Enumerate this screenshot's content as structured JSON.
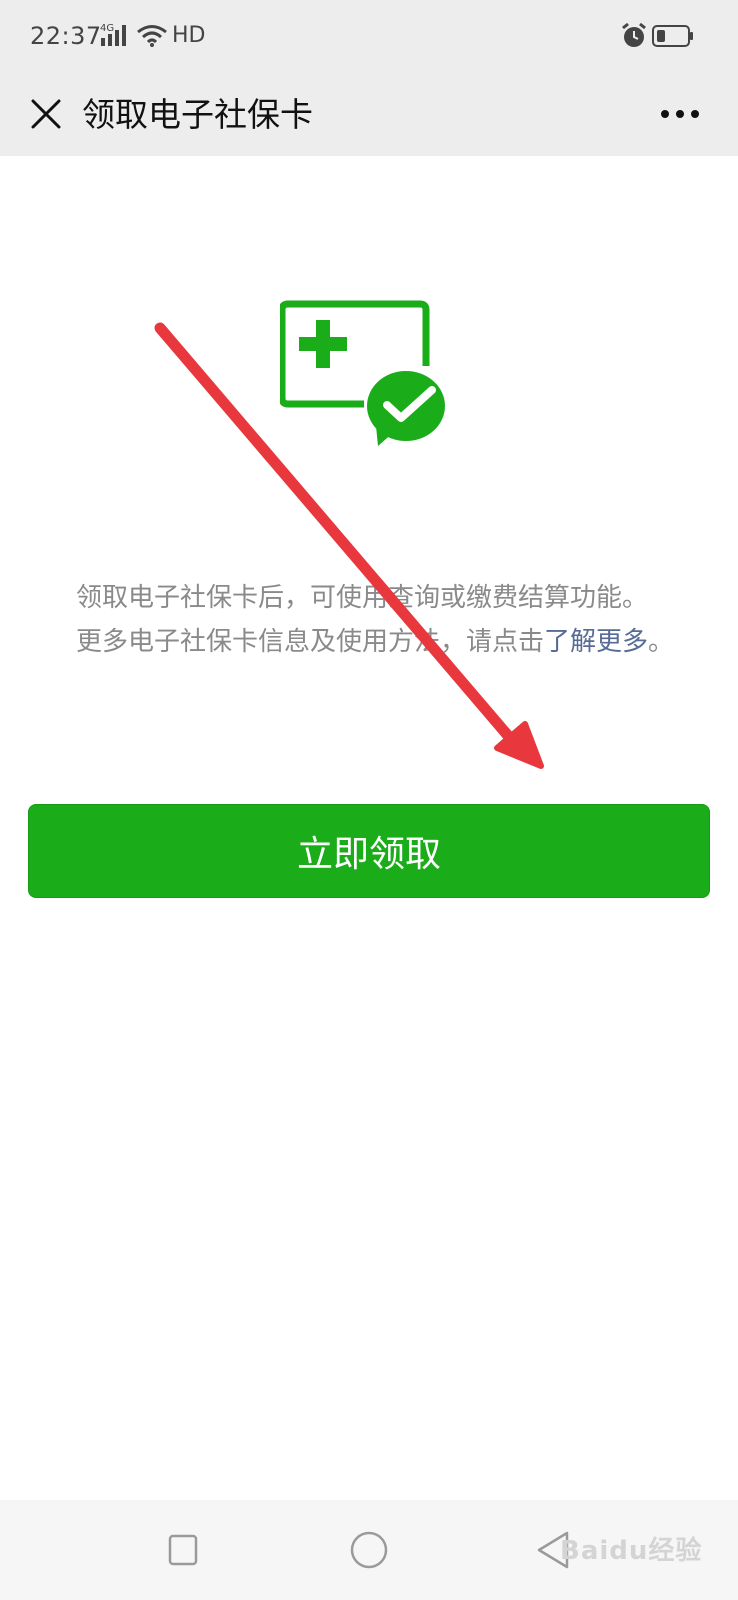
{
  "status_bar": {
    "time": "22:37",
    "network": "4G",
    "network_quality": "HD",
    "icons": [
      "signal-icon",
      "wifi-icon",
      "alarm-icon",
      "battery-icon"
    ]
  },
  "nav": {
    "title": "领取电子社保卡",
    "close_icon": "close-icon",
    "more_icon": "more-icon"
  },
  "hero": {
    "icon": "social-security-card-icon",
    "badge_icon": "wechat-check-badge-icon",
    "accent_color": "#1aad19"
  },
  "description": {
    "text": "领取电子社保卡后，可使用查询或缴费结算功能。 更多电子社保卡信息及使用方法，请点击",
    "link_text": "了解更多",
    "end_punct": "。",
    "link_color": "#576b95"
  },
  "claim_button": {
    "label": "立即领取",
    "color": "#1aad19"
  },
  "annotation": {
    "arrow_color": "#e8383d"
  },
  "system_nav": {
    "icons": [
      "recent-apps-icon",
      "home-icon",
      "back-icon"
    ]
  },
  "watermark": {
    "text": "Baidu经验"
  }
}
